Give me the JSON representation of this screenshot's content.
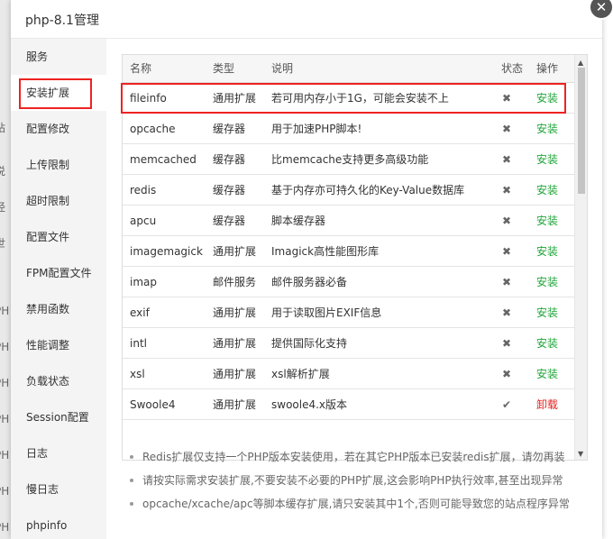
{
  "background_chars": [
    "站",
    "说",
    "经",
    "世",
    "PH",
    "PH",
    "PH",
    "PH",
    "PH",
    "PH",
    "PH",
    "PH",
    "PH"
  ],
  "dialog": {
    "title": "php-8.1管理",
    "close_icon": "✕"
  },
  "sidebar": {
    "items": [
      {
        "label": "服务"
      },
      {
        "label": "安装扩展",
        "active": true
      },
      {
        "label": "配置修改"
      },
      {
        "label": "上传限制"
      },
      {
        "label": "超时限制"
      },
      {
        "label": "配置文件"
      },
      {
        "label": "FPM配置文件"
      },
      {
        "label": "禁用函数"
      },
      {
        "label": "性能调整"
      },
      {
        "label": "负载状态"
      },
      {
        "label": "Session配置"
      },
      {
        "label": "日志"
      },
      {
        "label": "慢日志"
      },
      {
        "label": "phpinfo"
      }
    ]
  },
  "table": {
    "headers": {
      "name": "名称",
      "type": "类型",
      "desc": "说明",
      "status": "状态",
      "op": "操作"
    },
    "rows": [
      {
        "name": "fileinfo",
        "type": "通用扩展",
        "desc": "若可用内存小于1G，可能会安装不上",
        "status": "✖",
        "op": "安装"
      },
      {
        "name": "opcache",
        "type": "缓存器",
        "desc": "用于加速PHP脚本!",
        "status": "✖",
        "op": "安装"
      },
      {
        "name": "memcached",
        "type": "缓存器",
        "desc": "比memcache支持更多高级功能",
        "status": "✖",
        "op": "安装"
      },
      {
        "name": "redis",
        "type": "缓存器",
        "desc": "基于内存亦可持久化的Key-Value数据库",
        "status": "✖",
        "op": "安装"
      },
      {
        "name": "apcu",
        "type": "缓存器",
        "desc": "脚本缓存器",
        "status": "✖",
        "op": "安装"
      },
      {
        "name": "imagemagick",
        "type": "通用扩展",
        "desc": "Imagick高性能图形库",
        "status": "✖",
        "op": "安装"
      },
      {
        "name": "imap",
        "type": "邮件服务",
        "desc": "邮件服务器必备",
        "status": "✖",
        "op": "安装"
      },
      {
        "name": "exif",
        "type": "通用扩展",
        "desc": "用于读取图片EXIF信息",
        "status": "✖",
        "op": "安装"
      },
      {
        "name": "intl",
        "type": "通用扩展",
        "desc": "提供国际化支持",
        "status": "✖",
        "op": "安装"
      },
      {
        "name": "xsl",
        "type": "通用扩展",
        "desc": "xsl解析扩展",
        "status": "✖",
        "op": "安装"
      },
      {
        "name": "Swoole4",
        "type": "通用扩展",
        "desc": "swoole4.x版本",
        "status": "✔",
        "op": "卸载"
      }
    ]
  },
  "scroll": {
    "up": "▲",
    "down": "▼"
  },
  "notes": [
    "Redis扩展仅支持一个PHP版本安装使用，若在其它PHP版本已安装redis扩展，请勿再装",
    "请按实际需求安装扩展,不要安装不必要的PHP扩展,这会影响PHP执行效率,甚至出现异常",
    "opcache/xcache/apc等脚本缓存扩展,请只安装其中1个,否则可能导致您的站点程序异常"
  ],
  "colors": {
    "install": "#20a53a",
    "uninstall": "#e22222",
    "highlight": "#ee2222"
  }
}
